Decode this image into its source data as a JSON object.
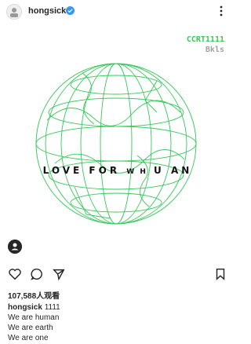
{
  "header": {
    "username": "hongsick",
    "verified_icon": "verified-badge-icon",
    "more_icon": "more-options-icon"
  },
  "post": {
    "brand_title": "CCRT1111",
    "brand_sub": "Bkls",
    "overlay_left": "LOVE FOR",
    "overlay_letters": "W H",
    "overlay_right": "U AN",
    "accent_color": "#37c85a"
  },
  "actions": {
    "like_icon": "heart-icon",
    "comment_icon": "comment-icon",
    "share_icon": "share-icon",
    "save_icon": "bookmark-icon"
  },
  "likes": "107,588人观看",
  "caption": {
    "username": "hongsick",
    "text_1": "1111",
    "line_2": "We are human",
    "line_3": "We are earth",
    "line_4": "We are one"
  }
}
